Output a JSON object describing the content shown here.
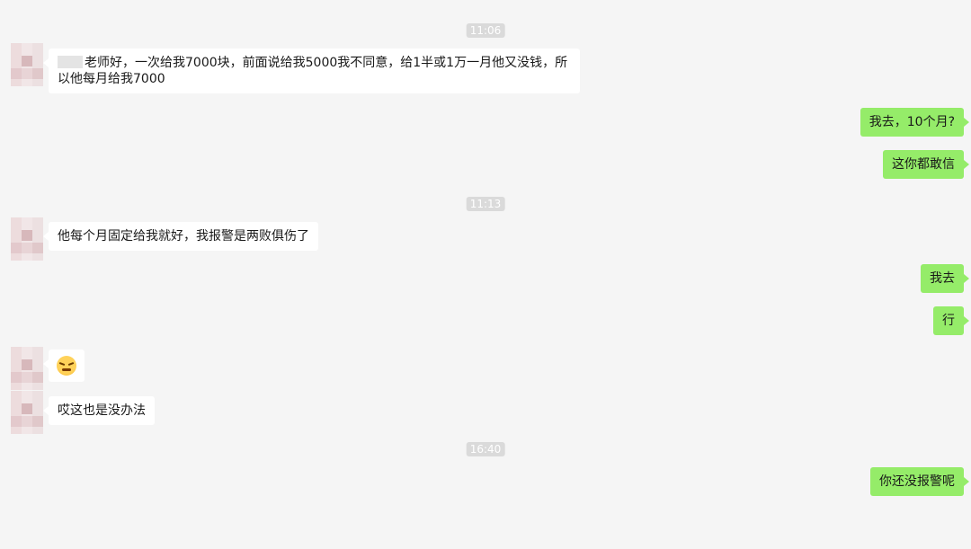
{
  "timestamps": {
    "t1": "11:06",
    "t2": "11:13",
    "t3": "16:40"
  },
  "messages": {
    "m1": "老师好，一次给我7000块，前面说给我5000我不同意，给1半或1万一月他又没钱，所以他每月给我7000",
    "m2": "我去，10个月?",
    "m3": "这你都敢信",
    "m4": "他每个月固定给我就好，我报警是两败俱伤了",
    "m5": "我去",
    "m6": "行",
    "m7_emoji": "angry-face-emoji",
    "m8": "哎这也是没办法",
    "m9": "你还没报警呢"
  },
  "colors": {
    "background": "#f5f5f5",
    "incoming_bubble": "#ffffff",
    "outgoing_bubble": "#95ec69",
    "timestamp_bg": "#dadada"
  }
}
